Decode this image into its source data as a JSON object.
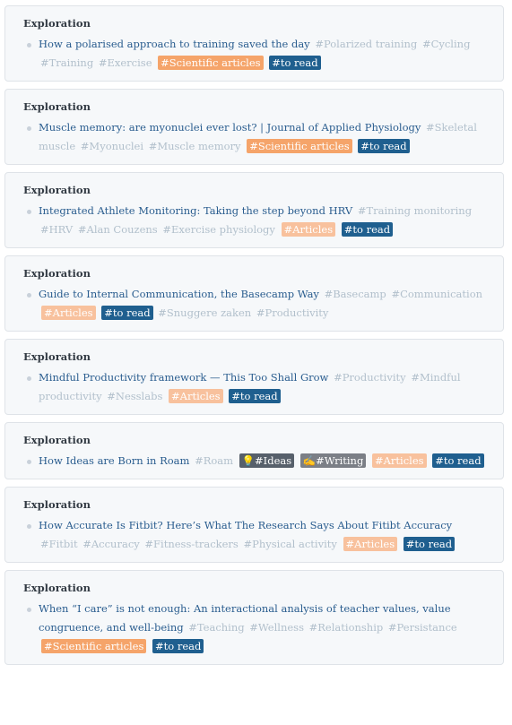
{
  "cards": [
    {
      "header": "Exploration",
      "title": "How a polarised approach to training saved the day",
      "tags": [
        {
          "text": "#Polarized training",
          "style": "plain"
        },
        {
          "text": "#Cycling",
          "style": "plain"
        },
        {
          "text": "#Training",
          "style": "plain"
        },
        {
          "text": "#Exercise",
          "style": "plain"
        },
        {
          "text": "#Scientific articles",
          "style": "orange"
        },
        {
          "text": "#to read",
          "style": "blue"
        }
      ]
    },
    {
      "header": "Exploration",
      "title": "Muscle memory: are myonuclei ever lost? | Journal of Applied Physiology",
      "tags": [
        {
          "text": "#Skeletal muscle",
          "style": "plain"
        },
        {
          "text": "#Myonuclei",
          "style": "plain"
        },
        {
          "text": "#Muscle memory",
          "style": "plain"
        },
        {
          "text": "#Scientific articles",
          "style": "orange"
        },
        {
          "text": "#to read",
          "style": "blue"
        }
      ]
    },
    {
      "header": "Exploration",
      "title": "Integrated Athlete Monitoring: Taking the step beyond HRV",
      "tags": [
        {
          "text": "#Training monitoring",
          "style": "plain"
        },
        {
          "text": "#HRV",
          "style": "plain"
        },
        {
          "text": "#Alan Couzens",
          "style": "plain"
        },
        {
          "text": "#Exercise physiology",
          "style": "plain"
        },
        {
          "text": "#Articles",
          "style": "peach"
        },
        {
          "text": "#to read",
          "style": "blue"
        }
      ]
    },
    {
      "header": "Exploration",
      "title": "Guide to Internal Communication, the Basecamp Way",
      "tags": [
        {
          "text": "#Basecamp",
          "style": "plain"
        },
        {
          "text": "#Communication",
          "style": "plain"
        },
        {
          "text": "#Articles",
          "style": "peach"
        },
        {
          "text": "#to read",
          "style": "blue"
        },
        {
          "text": "#Snuggere zaken",
          "style": "plain"
        },
        {
          "text": "#Productivity",
          "style": "plain"
        }
      ]
    },
    {
      "header": "Exploration",
      "title": "Mindful Productivity framework — This Too Shall Grow",
      "tags": [
        {
          "text": "#Productivity",
          "style": "plain"
        },
        {
          "text": "#Mindful productivity",
          "style": "plain"
        },
        {
          "text": "#Nesslabs",
          "style": "plain"
        },
        {
          "text": "#Articles",
          "style": "peach"
        },
        {
          "text": "#to read",
          "style": "blue"
        }
      ]
    },
    {
      "header": "Exploration",
      "title": "How Ideas are Born in Roam",
      "tags": [
        {
          "text": "#Roam",
          "style": "plain"
        },
        {
          "text": "💡#Ideas",
          "style": "dark"
        },
        {
          "text": "✍️#Writing",
          "style": "gray"
        },
        {
          "text": "#Articles",
          "style": "peach"
        },
        {
          "text": "#to read",
          "style": "blue"
        }
      ]
    },
    {
      "header": "Exploration",
      "title": "How Accurate Is Fitbit? Here’s What The Research Says About Fitibt Accuracy",
      "tags": [
        {
          "text": "#Fitbit",
          "style": "plain"
        },
        {
          "text": "#Accuracy",
          "style": "plain"
        },
        {
          "text": "#Fitness-trackers",
          "style": "plain"
        },
        {
          "text": "#Physical activity",
          "style": "plain"
        },
        {
          "text": "#Articles",
          "style": "peach"
        },
        {
          "text": "#to read",
          "style": "blue"
        }
      ]
    },
    {
      "header": "Exploration",
      "title": "When “I care” is not enough: An interactional analysis of teacher values, value congruence, and well-being",
      "tags": [
        {
          "text": "#Teaching",
          "style": "plain"
        },
        {
          "text": "#Wellness",
          "style": "plain"
        },
        {
          "text": "#Relationship",
          "style": "plain"
        },
        {
          "text": "#Persistance",
          "style": "plain"
        },
        {
          "text": "#Scientific articles",
          "style": "orange"
        },
        {
          "text": "#to read",
          "style": "blue"
        }
      ]
    }
  ]
}
